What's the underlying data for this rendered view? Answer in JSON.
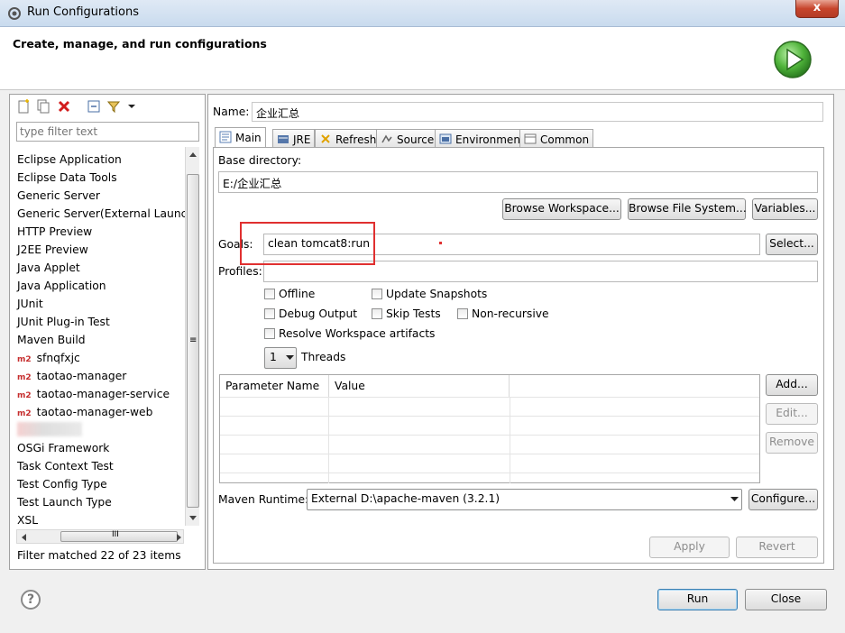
{
  "window": {
    "title": "Run Configurations",
    "close_label": "x"
  },
  "header": {
    "title": "Create, manage, and run configurations"
  },
  "left": {
    "filter_placeholder": "type filter text",
    "items": [
      {
        "label": "Eclipse Application",
        "m2": false
      },
      {
        "label": "Eclipse Data Tools",
        "m2": false
      },
      {
        "label": "Generic Server",
        "m2": false
      },
      {
        "label": "Generic Server(External Launch)",
        "m2": false
      },
      {
        "label": "HTTP Preview",
        "m2": false
      },
      {
        "label": "J2EE Preview",
        "m2": false
      },
      {
        "label": "Java Applet",
        "m2": false
      },
      {
        "label": "Java Application",
        "m2": false
      },
      {
        "label": "JUnit",
        "m2": false
      },
      {
        "label": "JUnit Plug-in Test",
        "m2": false
      },
      {
        "label": "Maven Build",
        "m2": false
      },
      {
        "label": "sfnqfxjc",
        "m2": true
      },
      {
        "label": "taotao-manager",
        "m2": true
      },
      {
        "label": "taotao-manager-service",
        "m2": true
      },
      {
        "label": "taotao-manager-web",
        "m2": true
      },
      {
        "label": "",
        "m2": false,
        "blurred": true
      },
      {
        "label": "OSGi Framework",
        "m2": false
      },
      {
        "label": "Task Context Test",
        "m2": false
      },
      {
        "label": "Test Config Type",
        "m2": false
      },
      {
        "label": "Test Launch Type",
        "m2": false
      },
      {
        "label": "XSL",
        "m2": false
      }
    ],
    "m2_badge": "m2",
    "hscroll_grip": "III",
    "vscroll_grip": "≡",
    "filter_status": "Filter matched 22 of 23 items"
  },
  "right": {
    "name_label": "Name:",
    "name_value": "企业汇总",
    "tabs": [
      "Main",
      "JRE",
      "Refresh",
      "Source",
      "Environment",
      "Common"
    ],
    "base_dir_label": "Base directory:",
    "base_dir_value": "E:/企业汇总",
    "browse_workspace": "Browse Workspace...",
    "browse_fs": "Browse File System...",
    "variables": "Variables...",
    "goals_label": "Goals:",
    "goals_value": "clean tomcat8:run",
    "select": "Select...",
    "profiles_label": "Profiles:",
    "profiles_value": "",
    "checkboxes": {
      "offline": "Offline",
      "update_snapshots": "Update Snapshots",
      "debug_output": "Debug Output",
      "skip_tests": "Skip Tests",
      "non_recursive": "Non-recursive",
      "resolve_workspace": "Resolve Workspace artifacts"
    },
    "threads_value": "1",
    "threads_label": "Threads",
    "param_headers": [
      "Parameter Name",
      "Value"
    ],
    "add": "Add...",
    "edit": "Edit...",
    "remove": "Remove",
    "runtime_label": "Maven Runtime:",
    "runtime_value": "External D:\\apache-maven (3.2.1)",
    "configure": "Configure...",
    "apply": "Apply",
    "revert": "Revert"
  },
  "bottom": {
    "help": "?",
    "run": "Run",
    "close": "Close"
  }
}
